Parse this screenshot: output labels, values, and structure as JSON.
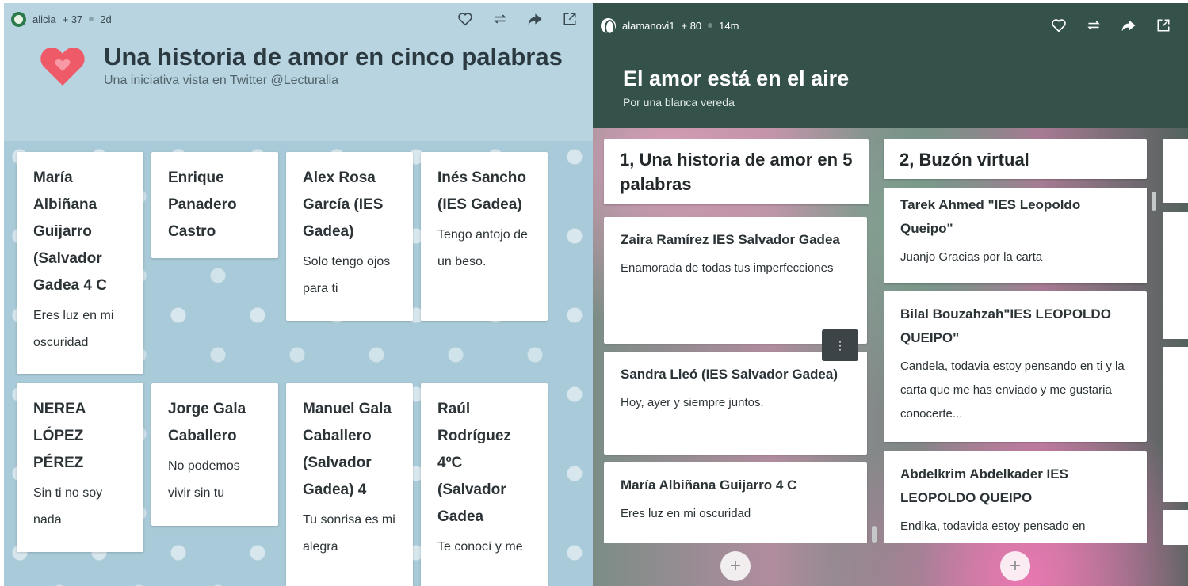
{
  "left_panel": {
    "author": "alicia",
    "score": "+ 37",
    "time": "2d",
    "icons": [
      "heart-outline-icon",
      "repost-icon",
      "share-arrow-icon",
      "open-external-icon"
    ],
    "title": "Una historia de amor en cinco palabras",
    "subtitle": "Una iniciativa vista en Twitter @Lecturalia",
    "accent_color": "#ef5a69",
    "notes": [
      {
        "title": "María Albiñana Guijarro (Salvador Gadea 4 C",
        "body": "Eres luz en mi oscuridad"
      },
      {
        "title": "Enrique Panadero Castro",
        "body": ""
      },
      {
        "title": "Alex Rosa García (IES Gadea)",
        "body": "Solo tengo ojos para ti"
      },
      {
        "title": "Inés Sancho (IES Gadea)",
        "body": "Tengo antojo de un beso."
      },
      {
        "title": "NEREA LÓPEZ PÉREZ",
        "body": "Sin ti no soy nada"
      },
      {
        "title": "Jorge Gala Caballero",
        "body": "No podemos vivir sin tu"
      },
      {
        "title": "Manuel Gala Caballero (Salvador Gadea) 4",
        "body": "Tu sonrisa es mi alegra"
      },
      {
        "title": "Raúl Rodríguez 4ºC (Salvador Gadea",
        "body": "Te conocí y me"
      }
    ]
  },
  "right_panel": {
    "author": "alamanovi1",
    "score": "+ 80",
    "time": "14m",
    "icons": [
      "heart-outline-icon",
      "repost-icon",
      "share-arrow-icon",
      "open-external-icon"
    ],
    "title": "El amor está en el aire",
    "subtitle": "Por una blanca vereda",
    "header_color": "#34514a",
    "columns": [
      {
        "heading": "1, Una historia de amor en 5 palabras",
        "cards": [
          {
            "title": "Zaira Ramírez IES Salvador Gadea",
            "body": " Enamorada de todas tus imperfecciones"
          },
          {
            "title": "Sandra Lleó (IES Salvador Gadea)",
            "body": "Hoy, ayer  y siempre juntos."
          },
          {
            "title": "María Albiñana Guijarro 4 C",
            "body": "Eres luz en mi oscuridad"
          }
        ],
        "add_label": "+"
      },
      {
        "heading": "2, Buzón virtual",
        "cards": [
          {
            "title": "Tarek Ahmed \"IES Leopoldo Queipo\"",
            "body": "Juanjo Gracias por la carta"
          },
          {
            "title": "Bilal Bouzahzah\"IES LEOPOLDO QUEIPO\"",
            "body": "Candela, todavia estoy pensando en ti y la carta que me has enviado y me gustaria conocerte..."
          },
          {
            "title": "Abdelkrim Abdelkader IES LEOPOLDO QUEIPO",
            "body": "Endika, todavida estoy pensado en"
          }
        ],
        "add_label": "+"
      }
    ],
    "more_label": "⋮"
  }
}
